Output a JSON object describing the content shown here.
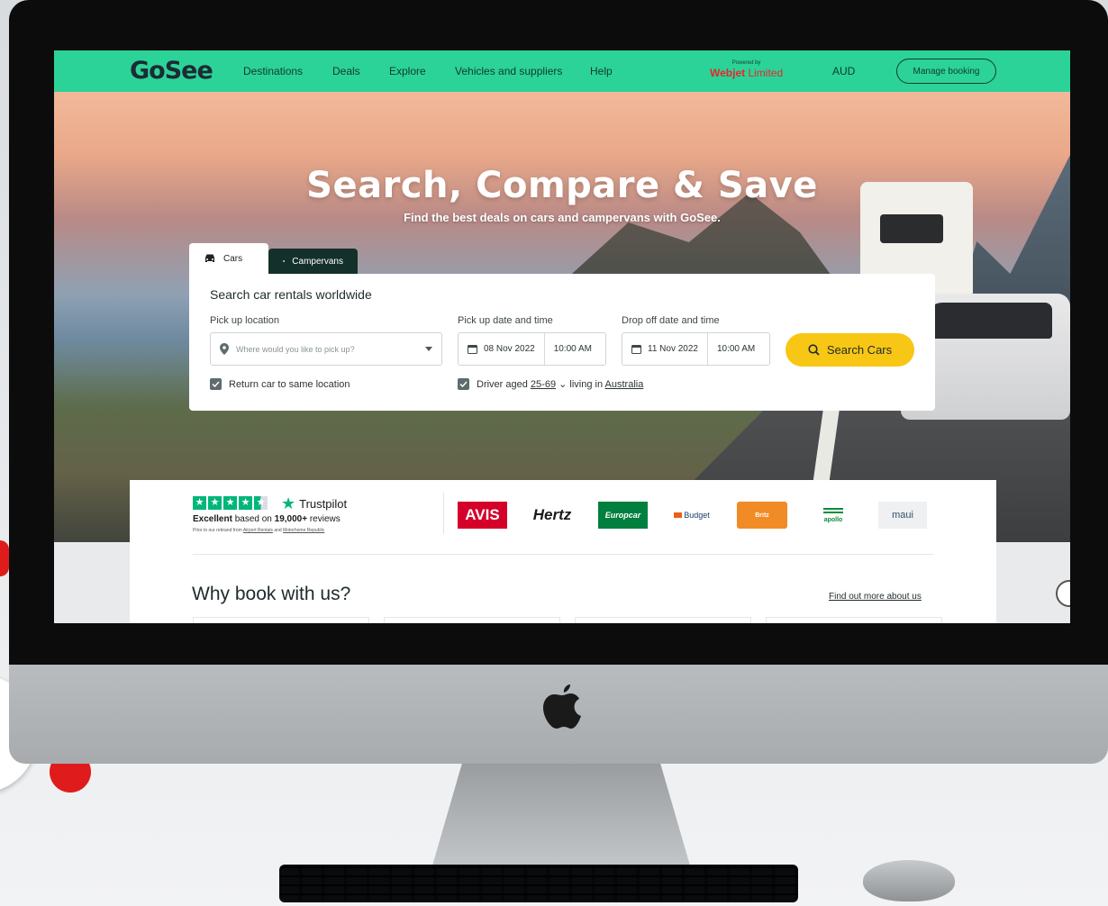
{
  "nav": {
    "logo": "GoSee",
    "items": [
      "Destinations",
      "Deals",
      "Explore",
      "Vehicles and suppliers",
      "Help"
    ],
    "powered_by": "Powered by",
    "partner_bold": "Webjet",
    "partner_rest": " Limited",
    "currency": "AUD",
    "manage_booking": "Manage booking"
  },
  "hero": {
    "title": "Search, Compare & Save",
    "subtitle": "Find the best deals on cars and campervans with GoSee."
  },
  "tabs": [
    {
      "label": "Cars",
      "icon": "car-icon",
      "active": true
    },
    {
      "label": "Campervans",
      "icon": "campervan-icon",
      "active": false
    }
  ],
  "search": {
    "title": "Search car rentals worldwide",
    "pickup_location_label": "Pick up location",
    "pickup_location_placeholder": "Where would you like to pick up?",
    "pickup_datetime_label": "Pick up date and time",
    "pickup_date": "08 Nov 2022",
    "pickup_time": "10:00 AM",
    "dropoff_datetime_label": "Drop off date and time",
    "dropoff_date": "11 Nov 2022",
    "dropoff_time": "10:00 AM",
    "search_button": "Search Cars",
    "return_same_location": "Return car to same location",
    "return_same_checked": true,
    "driver_prefix": "Driver aged ",
    "driver_age": "25-69",
    "driver_mid": " living in ",
    "driver_country": "Australia",
    "driver_checked": true
  },
  "trustpilot": {
    "brand": "Trustpilot",
    "rating_word": "Excellent",
    "rating_mid": " based on ",
    "review_count": "19,000+",
    "rating_suffix": " reviews",
    "stars": 4.5,
    "note_prefix": "Prior to our rebrand from ",
    "note_link1": "Airport Rentals",
    "note_mid": " and ",
    "note_link2": "Motorhome Republic"
  },
  "brands": [
    "AVIS",
    "Hertz",
    "Europcar",
    "Budget",
    "Britz",
    "apollo",
    "maui"
  ],
  "why": {
    "title": "Why book with us?",
    "link": "Find out more about us"
  },
  "colors": {
    "nav_green": "#2bd398",
    "search_yellow": "#f8c615",
    "tab_dark": "#14302a",
    "trustpilot_green": "#00b67a",
    "webjet_red": "#e8262c"
  }
}
